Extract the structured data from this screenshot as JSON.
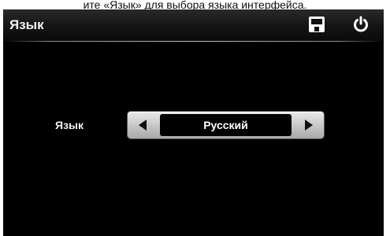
{
  "caption": "ите «Язык» для выбора языка интерфейса.",
  "header": {
    "title": "Язык"
  },
  "settings": {
    "language_label": "Язык",
    "language_value": "Русский"
  },
  "icons": {
    "save": "floppy-disk-icon",
    "power": "power-icon",
    "prev": "triangle-left-icon",
    "next": "triangle-right-icon"
  },
  "colors": {
    "background": "#000000",
    "text": "#ffffff",
    "selector": "#c9c9c9"
  }
}
